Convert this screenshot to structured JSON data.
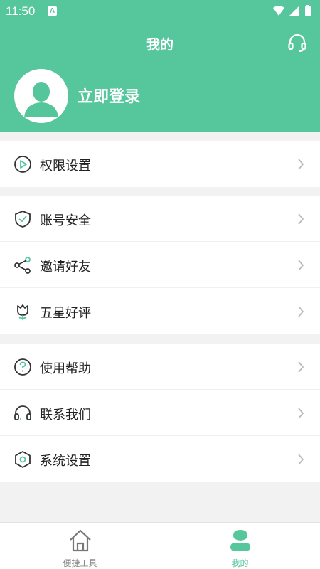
{
  "status_bar": {
    "time": "11:50",
    "notification_letter": "A"
  },
  "header": {
    "title": "我的",
    "login_text": "立即登录"
  },
  "menu": {
    "permissions": {
      "label": "权限设置",
      "icon": "play-circle-icon"
    },
    "account_security": {
      "label": "账号安全",
      "icon": "shield-check-icon"
    },
    "invite_friends": {
      "label": "邀请好友",
      "icon": "share-icon"
    },
    "five_star": {
      "label": "五星好评",
      "icon": "flower-icon"
    },
    "help": {
      "label": "使用帮助",
      "icon": "question-circle-icon"
    },
    "contact": {
      "label": "联系我们",
      "icon": "headset-icon"
    },
    "system_settings": {
      "label": "系统设置",
      "icon": "hexagon-settings-icon"
    }
  },
  "bottom_nav": {
    "tools_label": "便捷工具",
    "mine_label": "我的"
  },
  "colors": {
    "accent": "#56c69c",
    "background": "#f2f2f2",
    "text": "#222222"
  }
}
